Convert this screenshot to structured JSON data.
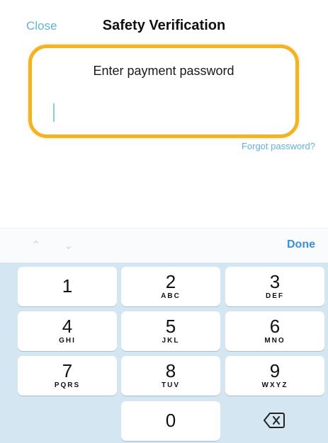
{
  "nav": {
    "close_label": "Close",
    "title": "Safety Verification"
  },
  "password": {
    "prompt": "Enter payment password",
    "value": ""
  },
  "forgot_label": "Forgot password?",
  "toolbar": {
    "up_icon": "chevron-up-icon",
    "down_icon": "chevron-down-icon",
    "done_label": "Done"
  },
  "keys": [
    {
      "num": "1",
      "letters": ""
    },
    {
      "num": "2",
      "letters": "ABC"
    },
    {
      "num": "3",
      "letters": "DEF"
    },
    {
      "num": "4",
      "letters": "GHI"
    },
    {
      "num": "5",
      "letters": "JKL"
    },
    {
      "num": "6",
      "letters": "MNO"
    },
    {
      "num": "7",
      "letters": "PQRS"
    },
    {
      "num": "8",
      "letters": "TUV"
    },
    {
      "num": "9",
      "letters": "WXYZ"
    },
    {
      "num": "0",
      "letters": ""
    }
  ],
  "colors": {
    "accent": "#5fb4d6",
    "highlight_border": "#f3b323",
    "keypad_bg": "#d3e6f2",
    "done": "#3f8fd0"
  }
}
